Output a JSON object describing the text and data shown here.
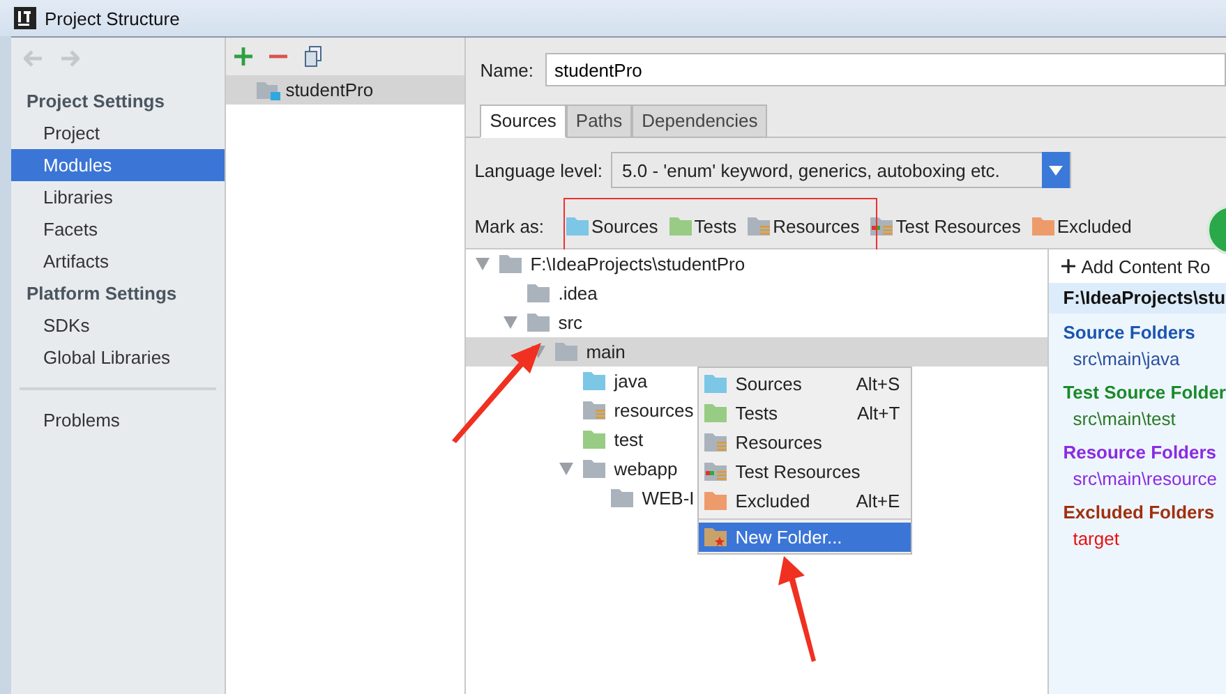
{
  "window": {
    "title": "Project Structure"
  },
  "sidebar": {
    "sections": [
      {
        "heading": "Project Settings",
        "items": [
          {
            "label": "Project",
            "selected": false
          },
          {
            "label": "Modules",
            "selected": true
          },
          {
            "label": "Libraries",
            "selected": false
          },
          {
            "label": "Facets",
            "selected": false
          },
          {
            "label": "Artifacts",
            "selected": false
          }
        ]
      },
      {
        "heading": "Platform Settings",
        "items": [
          {
            "label": "SDKs",
            "selected": false
          },
          {
            "label": "Global Libraries",
            "selected": false
          }
        ]
      }
    ],
    "footer_items": [
      {
        "label": "Problems",
        "selected": false
      }
    ]
  },
  "modules": {
    "items": [
      {
        "label": "studentPro",
        "selected": true
      }
    ]
  },
  "name_field": {
    "label": "Name:",
    "value": "studentPro"
  },
  "tabs": [
    {
      "label": "Sources",
      "selected": true
    },
    {
      "label": "Paths",
      "selected": false
    },
    {
      "label": "Dependencies",
      "selected": false
    }
  ],
  "language_level": {
    "label": "Language level:",
    "value": "5.0 - 'enum' keyword, generics, autoboxing etc."
  },
  "mark_as": {
    "label": "Mark as:",
    "options": [
      {
        "label": "Sources",
        "kind": "sources"
      },
      {
        "label": "Tests",
        "kind": "tests"
      },
      {
        "label": "Resources",
        "kind": "resources"
      },
      {
        "label": "Test Resources",
        "kind": "test_resources"
      },
      {
        "label": "Excluded",
        "kind": "excluded"
      }
    ]
  },
  "tree": [
    {
      "label": "F:\\IdeaProjects\\studentPro",
      "kind": "plain",
      "expanded": true,
      "selected": false,
      "children": [
        {
          "label": ".idea",
          "kind": "plain",
          "selected": false
        },
        {
          "label": "src",
          "kind": "plain",
          "expanded": true,
          "selected": false,
          "children": [
            {
              "label": "main",
              "kind": "plain",
              "expanded": true,
              "selected": true,
              "children": [
                {
                  "label": "java",
                  "kind": "sources",
                  "selected": false
                },
                {
                  "label": "resources",
                  "kind": "resources",
                  "selected": false
                },
                {
                  "label": "test",
                  "kind": "tests",
                  "selected": false
                },
                {
                  "label": "webapp",
                  "kind": "plain",
                  "expanded": true,
                  "selected": false,
                  "children": [
                    {
                      "label": "WEB-I",
                      "kind": "plain",
                      "selected": false
                    }
                  ]
                }
              ]
            }
          ]
        }
      ]
    }
  ],
  "context_menu": {
    "items": [
      {
        "label": "Sources",
        "shortcut": "Alt+S",
        "kind": "sources",
        "selected": false
      },
      {
        "label": "Tests",
        "shortcut": "Alt+T",
        "kind": "tests",
        "selected": false
      },
      {
        "label": "Resources",
        "kind": "resources",
        "selected": false
      },
      {
        "label": "Test Resources",
        "kind": "test_resources",
        "selected": false
      },
      {
        "label": "Excluded",
        "shortcut": "Alt+E",
        "kind": "excluded",
        "selected": false
      },
      {
        "label": "New Folder...",
        "kind": "new_folder",
        "selected": true
      }
    ]
  },
  "content_root": {
    "add_label": "Add Content Ro",
    "path": "F:\\IdeaProjects\\stu",
    "groups": [
      {
        "heading": "Source Folders",
        "kind": "sources",
        "paths": [
          "src\\main\\java"
        ]
      },
      {
        "heading": "Test Source Folder",
        "kind": "tests",
        "paths": [
          "src\\main\\test"
        ]
      },
      {
        "heading": "Resource Folders",
        "kind": "resources",
        "paths": [
          "src\\main\\resource"
        ]
      },
      {
        "heading": "Excluded Folders",
        "kind": "excluded",
        "paths": [
          "target"
        ]
      }
    ]
  }
}
